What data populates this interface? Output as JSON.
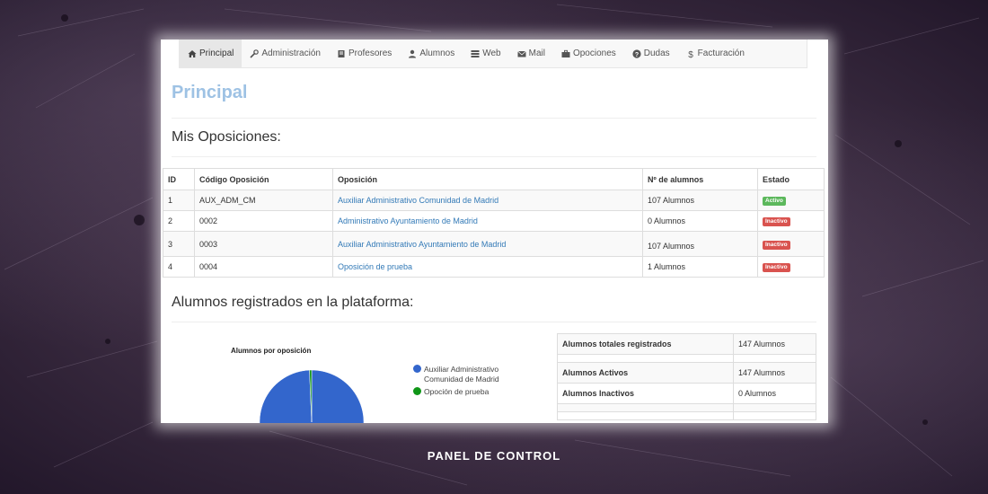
{
  "nav": {
    "items": [
      {
        "label": "Principal",
        "icon": "home-icon"
      },
      {
        "label": "Administración",
        "icon": "wrench-icon"
      },
      {
        "label": "Profesores",
        "icon": "book-icon"
      },
      {
        "label": "Alumnos",
        "icon": "user-icon"
      },
      {
        "label": "Web",
        "icon": "list-icon"
      },
      {
        "label": "Mail",
        "icon": "envelope-icon"
      },
      {
        "label": "Opociones",
        "icon": "briefcase-icon"
      },
      {
        "label": "Dudas",
        "icon": "question-icon"
      },
      {
        "label": "Facturación",
        "icon": "dollar-icon"
      }
    ],
    "active_index": 0
  },
  "page": {
    "title": "Principal",
    "section_oposiciones": "Mis Oposiciones:",
    "section_alumnos": "Alumnos registrados en la plataforma:"
  },
  "oposiciones_table": {
    "columns": [
      "ID",
      "Código Oposición",
      "Oposición",
      "Nº de alumnos",
      "Estado"
    ],
    "rows": [
      {
        "id": "1",
        "codigo": "AUX_ADM_CM",
        "oposicion": "Auxiliar Administrativo Comunidad de Madrid",
        "alumnos": "107 Alumnos",
        "estado": "Activo",
        "estado_type": "success"
      },
      {
        "id": "2",
        "codigo": "0002",
        "oposicion": "Administrativo Ayuntamiento de Madrid",
        "alumnos": "0 Alumnos",
        "estado": "Inactivo",
        "estado_type": "danger"
      },
      {
        "id": "3",
        "codigo": "0003",
        "oposicion": "Auxiliar Administrativo Ayuntamiento de Madrid",
        "alumnos": "107 Alumnos",
        "estado": "Inactivo",
        "estado_type": "danger"
      },
      {
        "id": "4",
        "codigo": "0004",
        "oposicion": "Oposición de prueba",
        "alumnos": "1 Alumnos",
        "estado": "Inactivo",
        "estado_type": "danger"
      }
    ]
  },
  "pie_chart": {
    "title": "Alumnos por oposición",
    "slices": [
      {
        "label": "Auxiliar Administrativo Comunidad de Madrid",
        "value": 146,
        "color": "#3366cc"
      },
      {
        "label": "Opoción de prueba",
        "value": 1,
        "color": "#109618"
      }
    ]
  },
  "stats_table": {
    "rows": [
      {
        "key": "Alumnos totales registrados",
        "value": "147 Alumnos"
      },
      {
        "key": "Alumnos Activos",
        "value": "147 Alumnos"
      },
      {
        "key": "Alumnos Inactivos",
        "value": "0 Alumnos"
      }
    ]
  },
  "caption": "PANEL DE CONTROL",
  "colors": {
    "link": "#337ab7",
    "title": "#9ec2e4",
    "label_success": "#5cb85c",
    "label_danger": "#d9534f"
  }
}
